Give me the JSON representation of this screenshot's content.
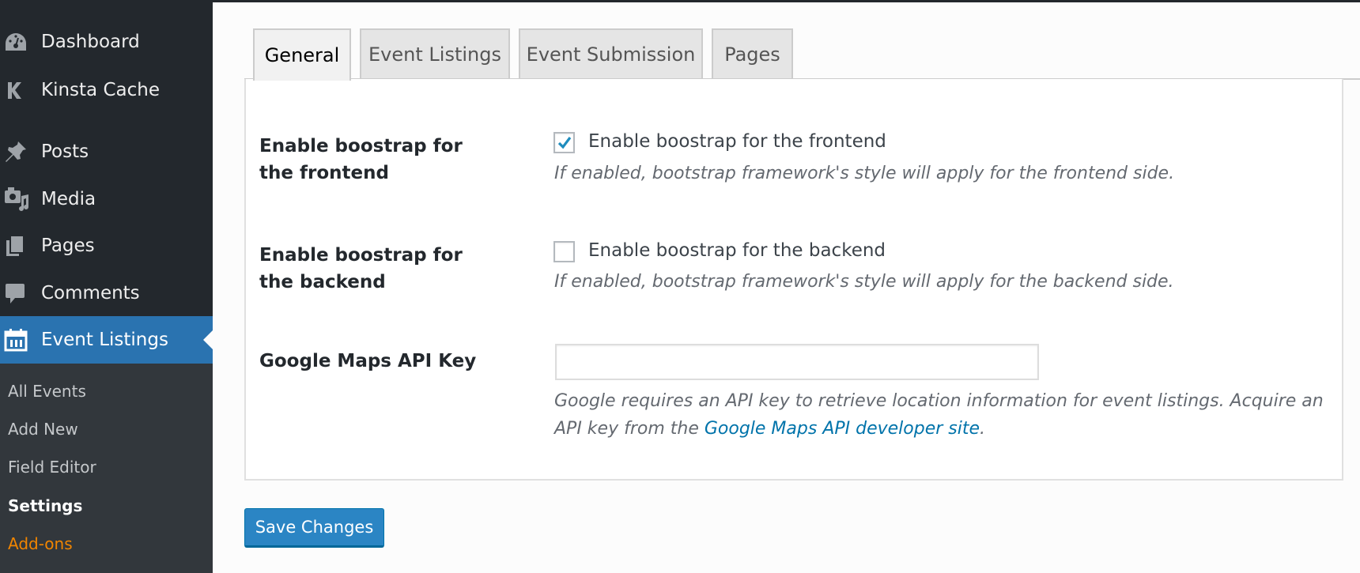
{
  "sidebar": {
    "items": [
      {
        "label": "Dashboard",
        "icon": "dashboard-icon"
      },
      {
        "label": "Kinsta Cache",
        "icon": "kinsta-icon"
      },
      {
        "label": "Posts",
        "icon": "pushpin-icon"
      },
      {
        "label": "Media",
        "icon": "media-icon"
      },
      {
        "label": "Pages",
        "icon": "pages-icon"
      },
      {
        "label": "Comments",
        "icon": "comment-icon"
      },
      {
        "label": "Event Listings",
        "icon": "calendar-icon",
        "active": true
      }
    ],
    "submenu": [
      {
        "label": "All Events"
      },
      {
        "label": "Add New"
      },
      {
        "label": "Field Editor"
      },
      {
        "label": "Settings",
        "current": true
      },
      {
        "label": "Add-ons"
      }
    ]
  },
  "tabs": [
    {
      "label": "General",
      "active": true
    },
    {
      "label": "Event Listings"
    },
    {
      "label": "Event Submission"
    },
    {
      "label": "Pages"
    }
  ],
  "settings": {
    "frontend": {
      "label": "Enable boostrap for the frontend",
      "checkbox_label": "Enable boostrap for the frontend",
      "checked": true,
      "description": "If enabled, bootstrap framework's style will apply for the frontend side."
    },
    "backend": {
      "label": "Enable boostrap for the backend",
      "checkbox_label": "Enable boostrap for the backend",
      "checked": false,
      "description": "If enabled, bootstrap framework's style will apply for the backend side."
    },
    "maps_key": {
      "label": "Google Maps API Key",
      "value": "",
      "description_line1": "Google requires an API key to retrieve location information for event listings. Acquire an",
      "description_line2_prefix": "API key from the ",
      "link_text": "Google Maps API developer site",
      "description_line2_suffix": "."
    }
  },
  "save_button": {
    "label": "Save Changes"
  },
  "colors": {
    "sidebar_bg": "#23282d",
    "submenu_bg": "#32373c",
    "active_menu": "#2a73b0",
    "addons": "#f18500",
    "link": "#0073aa",
    "button": "#2b85c4"
  }
}
